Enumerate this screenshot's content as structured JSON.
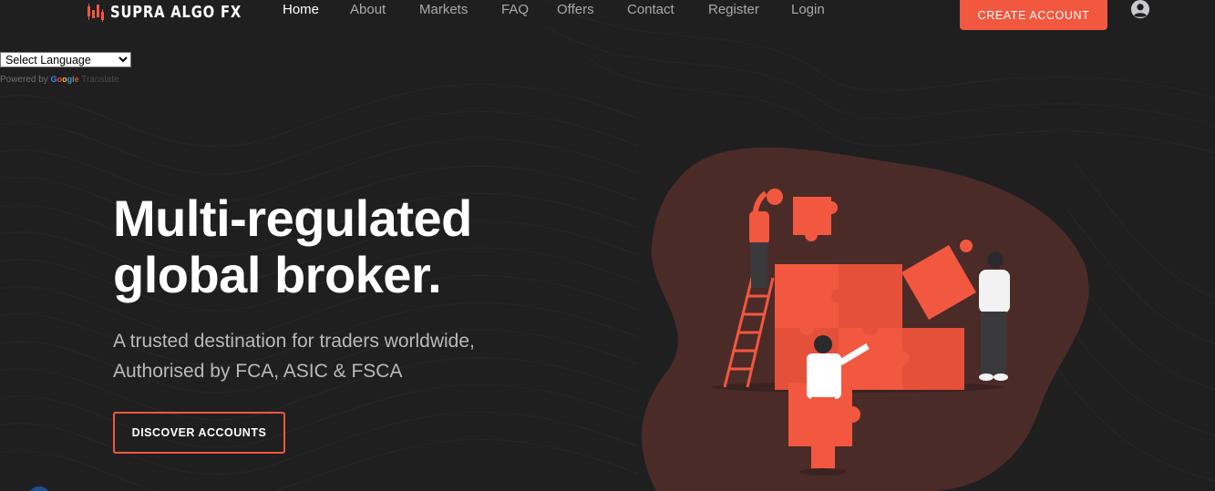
{
  "brand": {
    "name": "SUPRA ALGO FX",
    "accent": "#f2573f",
    "background": "#1f1f20"
  },
  "nav": {
    "items": [
      {
        "label": "Home",
        "active": true
      },
      {
        "label": "About"
      },
      {
        "label": "Markets"
      },
      {
        "label": "FAQ"
      },
      {
        "label": "Offers"
      },
      {
        "label": "Contact"
      },
      {
        "label": "Register"
      },
      {
        "label": "Login"
      }
    ],
    "cta_label": "CREATE ACCOUNT",
    "user_icon": "user-circle-icon"
  },
  "translate": {
    "select_value": "Select Language",
    "powered_by": "Powered by",
    "google": "Google",
    "translate": "Translate"
  },
  "hero": {
    "headline_line1": "Multi-regulated",
    "headline_line2": "global broker.",
    "sub_line1": "A trusted destination for traders worldwide,",
    "sub_line2": "Authorised by FCA, ASIC & FSCA",
    "button_label": "DISCOVER ACCOUNTS",
    "illustration_icon": "puzzle-team-illustration"
  }
}
